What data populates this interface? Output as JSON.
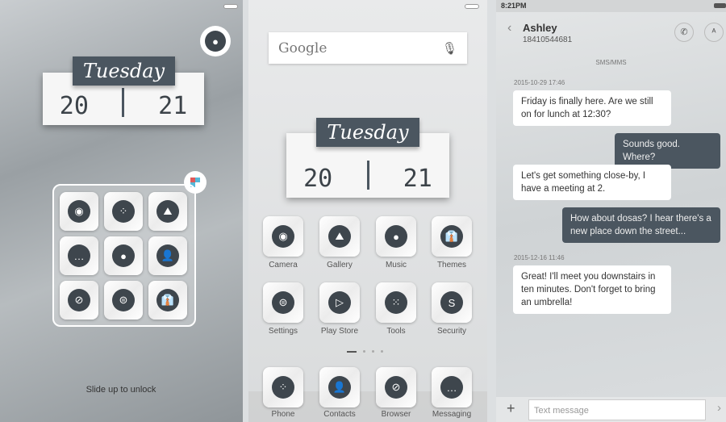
{
  "lock": {
    "day": "Tuesday",
    "hour": "20",
    "minute": "21",
    "unlock_text": "Slide up to unlock",
    "folder_icons": [
      "camera",
      "phone-dialpad",
      "gallery",
      "messaging",
      "music",
      "contacts",
      "browser",
      "settings",
      "themes"
    ]
  },
  "home": {
    "search_logo": "Google",
    "day": "Tuesday",
    "hour": "20",
    "minute": "21",
    "apps": [
      {
        "label": "Camera",
        "icon": "camera"
      },
      {
        "label": "Gallery",
        "icon": "gallery"
      },
      {
        "label": "Music",
        "icon": "music"
      },
      {
        "label": "Themes",
        "icon": "themes"
      },
      {
        "label": "Settings",
        "icon": "settings"
      },
      {
        "label": "Play Store",
        "icon": "play-store"
      },
      {
        "label": "Tools",
        "icon": "tools"
      },
      {
        "label": "Security",
        "icon": "security"
      }
    ],
    "page_count": 4,
    "current_page": 1,
    "dock": [
      {
        "label": "Phone",
        "icon": "phone-dialpad"
      },
      {
        "label": "Contacts",
        "icon": "contacts"
      },
      {
        "label": "Browser",
        "icon": "browser"
      },
      {
        "label": "Messaging",
        "icon": "messaging"
      }
    ]
  },
  "messages": {
    "time": "8:21PM",
    "contact": "Ashley",
    "number": "18410544681",
    "channel": "SMS/MMS",
    "thread": [
      {
        "type": "timestamp",
        "text": "2015-10-29 17:46"
      },
      {
        "type": "in",
        "text": "Friday is finally here. Are we still on for lunch at 12:30?"
      },
      {
        "type": "out",
        "text": "Sounds good. Where?"
      },
      {
        "type": "in",
        "text": "Let's get something close-by, I have a meeting at 2."
      },
      {
        "type": "out",
        "text": "How about dosas? I hear there's a new place down the street..."
      },
      {
        "type": "timestamp",
        "text": "2015-12-16 11:46"
      },
      {
        "type": "in",
        "text": "Great! I'll meet you downstairs in ten minutes. Don't forget to bring an umbrella!"
      }
    ],
    "input_placeholder": "Text message"
  },
  "colors": {
    "accent": "#4b5660",
    "bubble_in": "#ffffff"
  }
}
